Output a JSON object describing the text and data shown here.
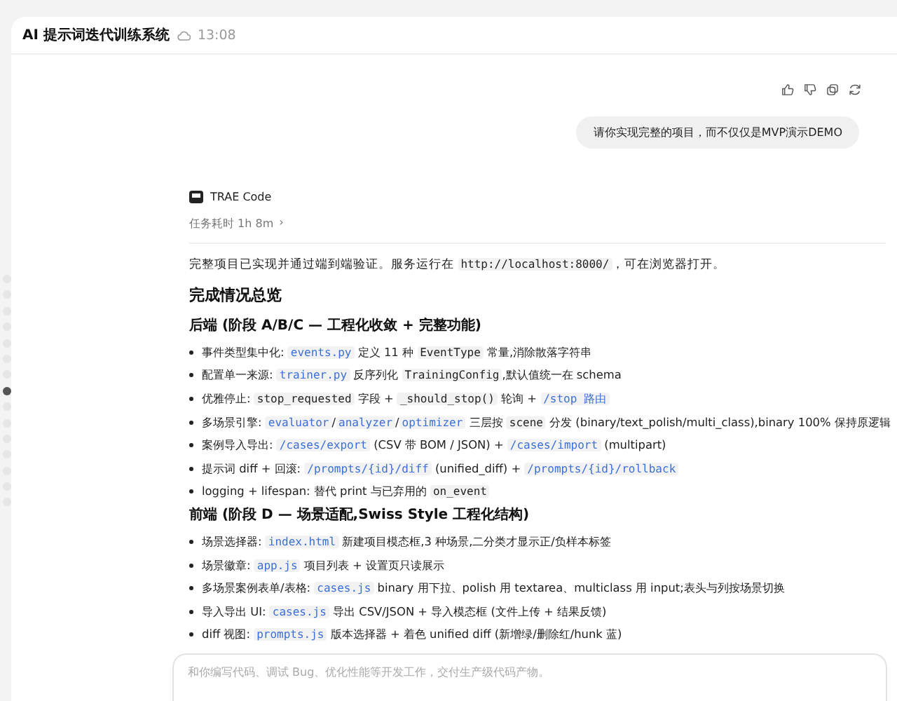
{
  "header": {
    "title": "AI 提示词迭代训练系统",
    "time": "13:08"
  },
  "message_actions": [
    {
      "kind": "like"
    },
    {
      "kind": "dislike"
    },
    {
      "kind": "copy"
    },
    {
      "kind": "retry"
    }
  ],
  "user_message": "请你实现完整的项目，而不仅仅是MVP演示DEMO",
  "agent": {
    "name": "TRAE Code",
    "duration": "任务耗时 1h 8m",
    "chevron": "›"
  },
  "answer": [
    {
      "kind": "para",
      "segments": [
        {
          "kind": "text",
          "text": "完整项目已实现并通过端到端验证。服务运行在 "
        },
        {
          "kind": "code",
          "text": "http://localhost:8000/"
        },
        {
          "kind": "text",
          "text": "，可在浏览器打开。"
        }
      ]
    },
    {
      "kind": "h2",
      "segments": [
        {
          "kind": "text",
          "text": "完成情况总览"
        }
      ]
    },
    {
      "kind": "h3",
      "segments": [
        {
          "kind": "text",
          "text": "后端 (阶段 A/B/C — 工程化收敛 + 完整功能)"
        }
      ]
    },
    {
      "kind": "bullet",
      "segments": [
        {
          "kind": "text",
          "text": "事件类型集中化: "
        },
        {
          "kind": "path",
          "text": "events.py"
        },
        {
          "kind": "text",
          "text": " 定义 11 种 "
        },
        {
          "kind": "code",
          "text": "EventType"
        },
        {
          "kind": "text",
          "text": " 常量,消除散落字符串"
        }
      ]
    },
    {
      "kind": "bullet",
      "segments": [
        {
          "kind": "text",
          "text": "配置单一来源: "
        },
        {
          "kind": "path",
          "text": "trainer.py"
        },
        {
          "kind": "text",
          "text": " 反序列化 "
        },
        {
          "kind": "code",
          "text": "TrainingConfig"
        },
        {
          "kind": "text",
          "text": ",默认值统一在 schema"
        }
      ]
    },
    {
      "kind": "bullet",
      "segments": [
        {
          "kind": "text",
          "text": "优雅停止: "
        },
        {
          "kind": "code",
          "text": "stop_requested"
        },
        {
          "kind": "text",
          "text": " 字段 + "
        },
        {
          "kind": "code",
          "text": "_should_stop()"
        },
        {
          "kind": "text",
          "text": " 轮询 + "
        },
        {
          "kind": "path",
          "text": "/stop 路由"
        }
      ]
    },
    {
      "kind": "bullet",
      "segments": [
        {
          "kind": "text",
          "text": "多场景引擎: "
        },
        {
          "kind": "path",
          "text": "evaluator"
        },
        {
          "kind": "text",
          "text": "/"
        },
        {
          "kind": "path",
          "text": "analyzer"
        },
        {
          "kind": "text",
          "text": "/"
        },
        {
          "kind": "path",
          "text": "optimizer"
        },
        {
          "kind": "text",
          "text": " 三层按 "
        },
        {
          "kind": "code",
          "text": "scene"
        },
        {
          "kind": "text",
          "text": " 分发 (binary/text_polish/multi_class),binary 100% 保持原逻辑"
        }
      ]
    },
    {
      "kind": "bullet",
      "segments": [
        {
          "kind": "text",
          "text": "案例导入导出: "
        },
        {
          "kind": "path",
          "text": "/cases/export"
        },
        {
          "kind": "text",
          "text": " (CSV 带 BOM / JSON) + "
        },
        {
          "kind": "path",
          "text": "/cases/import"
        },
        {
          "kind": "text",
          "text": " (multipart)"
        }
      ]
    },
    {
      "kind": "bullet",
      "segments": [
        {
          "kind": "text",
          "text": "提示词 diff + 回滚: "
        },
        {
          "kind": "path",
          "text": "/prompts/{id}/diff"
        },
        {
          "kind": "text",
          "text": " (unified_diff) + "
        },
        {
          "kind": "path",
          "text": "/prompts/{id}/rollback"
        }
      ]
    },
    {
      "kind": "bullet",
      "segments": [
        {
          "kind": "text",
          "text": "logging + lifespan: 替代 print 与已弃用的 "
        },
        {
          "kind": "code",
          "text": "on_event"
        }
      ]
    },
    {
      "kind": "h3",
      "segments": [
        {
          "kind": "text",
          "text": "前端 (阶段 D — 场景适配,Swiss Style 工程化结构)"
        }
      ]
    },
    {
      "kind": "bullet",
      "segments": [
        {
          "kind": "text",
          "text": "场景选择器: "
        },
        {
          "kind": "path",
          "text": "index.html"
        },
        {
          "kind": "text",
          "text": " 新建项目模态框,3 种场景,二分类才显示正/负样本标签"
        }
      ]
    },
    {
      "kind": "bullet",
      "segments": [
        {
          "kind": "text",
          "text": "场景徽章: "
        },
        {
          "kind": "path",
          "text": "app.js"
        },
        {
          "kind": "text",
          "text": " 项目列表 + 设置页只读展示"
        }
      ]
    },
    {
      "kind": "bullet",
      "segments": [
        {
          "kind": "text",
          "text": "多场景案例表单/表格: "
        },
        {
          "kind": "path",
          "text": "cases.js"
        },
        {
          "kind": "text",
          "text": " binary 用下拉、polish 用 textarea、multiclass 用 input;表头与列按场景切换"
        }
      ]
    },
    {
      "kind": "bullet",
      "segments": [
        {
          "kind": "text",
          "text": "导入导出 UI: "
        },
        {
          "kind": "path",
          "text": "cases.js"
        },
        {
          "kind": "text",
          "text": " 导出 CSV/JSON + 导入模态框 (文件上传 + 结果反馈)"
        }
      ]
    },
    {
      "kind": "bullet",
      "segments": [
        {
          "kind": "text",
          "text": "diff 视图: "
        },
        {
          "kind": "path",
          "text": "prompts.js"
        },
        {
          "kind": "text",
          "text": " 版本选择器 + 着色 unified diff (新增绿/删除红/hunk 蓝)"
        }
      ]
    }
  ],
  "nav_dots": [
    {
      "selected": false
    },
    {
      "selected": false
    },
    {
      "selected": false
    },
    {
      "selected": false
    },
    {
      "selected": false
    },
    {
      "selected": false
    },
    {
      "selected": false
    },
    {
      "selected": true
    },
    {
      "selected": false
    },
    {
      "selected": false
    },
    {
      "selected": false
    },
    {
      "selected": false
    },
    {
      "selected": false
    },
    {
      "selected": false
    },
    {
      "selected": false
    }
  ],
  "composer": {
    "placeholder": "和你编写代码、调试 Bug、优化性能等开发工作，交付生产级代码产物。"
  }
}
